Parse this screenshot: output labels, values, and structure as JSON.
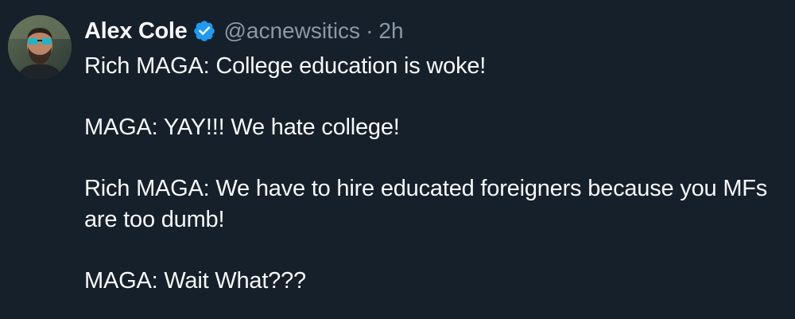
{
  "tweet": {
    "author_name": "Alex Cole",
    "handle": "@acnewsitics",
    "separator": "·",
    "timestamp": "2h",
    "verified_icon": "verified-badge-icon",
    "paragraphs": [
      "Rich MAGA: College education is woke!",
      "MAGA: YAY!!! We hate college!",
      "Rich MAGA: We have to hire educated foreigners because you MFs are too dumb!",
      "MAGA: Wait What???"
    ]
  },
  "colors": {
    "background": "#15202b",
    "text_primary": "#f7f9f9",
    "text_secondary": "#8b98a5",
    "verified_blue": "#1d9bf0"
  }
}
